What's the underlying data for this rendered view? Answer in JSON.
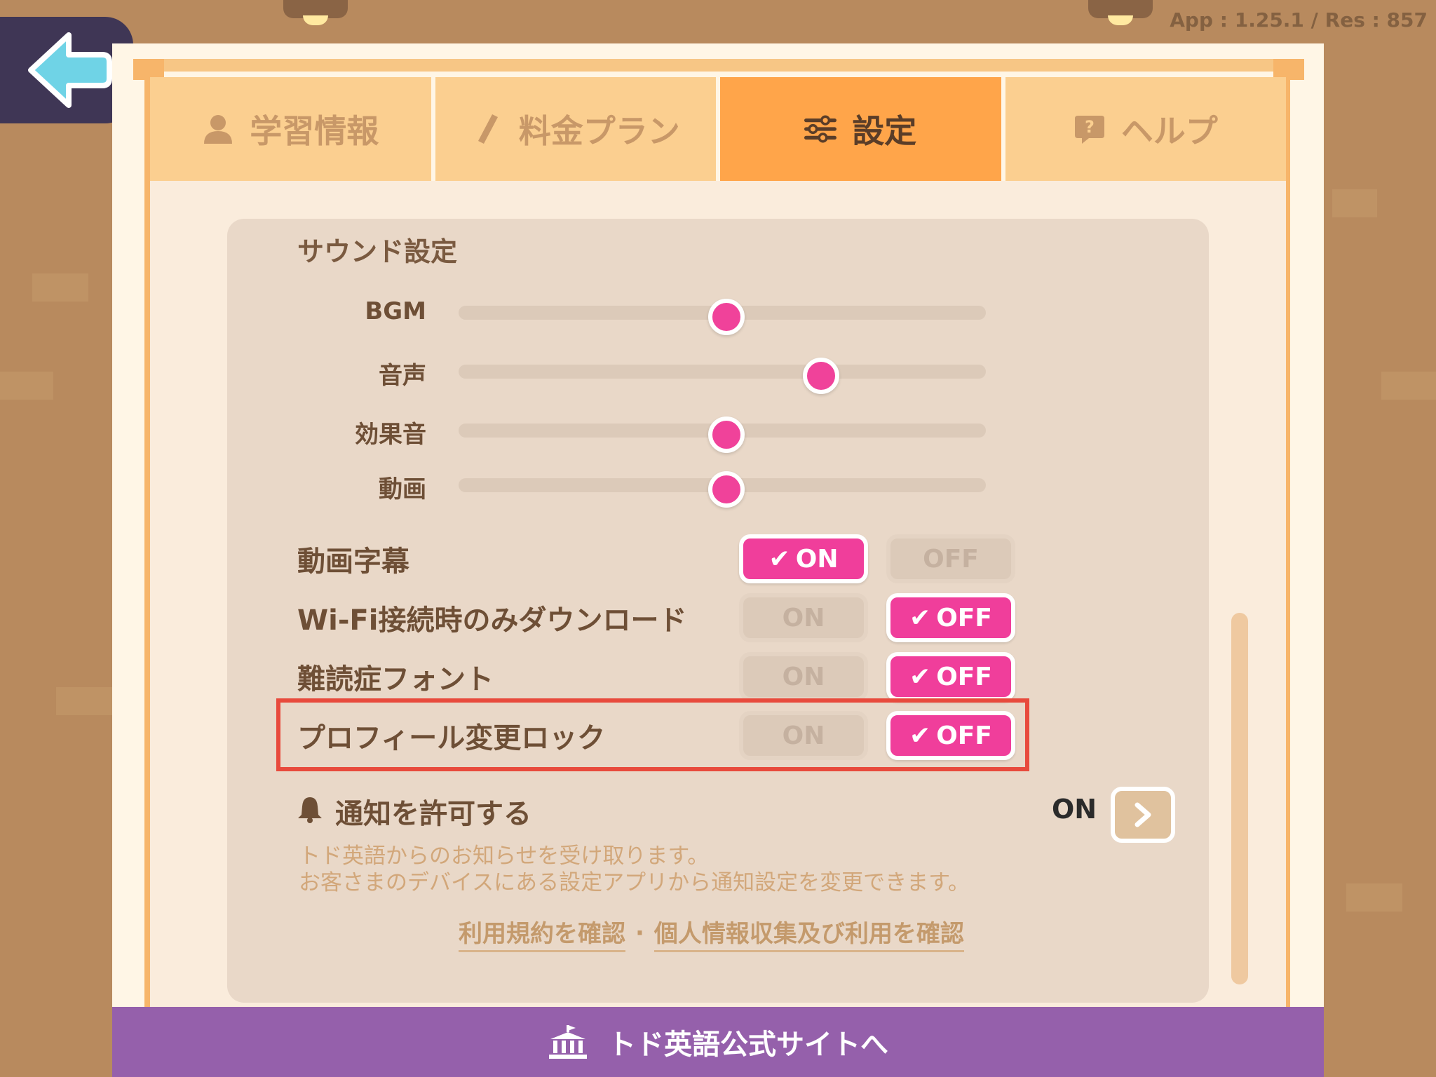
{
  "version_text": "App : 1.25.1 / Res : 857",
  "tabs": [
    {
      "label": "学習情報",
      "icon": "person-icon"
    },
    {
      "label": "料金プラン",
      "icon": "pen-icon"
    },
    {
      "label": "設定",
      "icon": "sliders-icon",
      "active": true
    },
    {
      "label": "ヘルプ",
      "icon": "help-icon"
    }
  ],
  "sound": {
    "title": "サウンド設定",
    "sliders": [
      {
        "label": "BGM",
        "value": 0.5
      },
      {
        "label": "音声",
        "value": 0.68
      },
      {
        "label": "効果音",
        "value": 0.5
      },
      {
        "label": "動画",
        "value": 0.5
      }
    ]
  },
  "toggles": [
    {
      "label": "動画字幕",
      "on_label": "ON",
      "off_label": "OFF",
      "selected": "on"
    },
    {
      "label": "Wi-Fi接続時のみダウンロード",
      "on_label": "ON",
      "off_label": "OFF",
      "selected": "off"
    },
    {
      "label": "難読症フォント",
      "on_label": "ON",
      "off_label": "OFF",
      "selected": "off"
    },
    {
      "label": "プロフィール変更ロック",
      "on_label": "ON",
      "off_label": "OFF",
      "selected": "off"
    }
  ],
  "notification": {
    "label": "通知を許可する",
    "status": "ON",
    "desc_line1": "トド英語からのお知らせを受け取ります。",
    "desc_line2": "お客さまのデバイスにある設定アプリから通知設定を変更できます。"
  },
  "links": {
    "terms": "利用規約を確認",
    "separator": "·",
    "privacy": "個人情報収集及び利用を確認"
  },
  "footer": {
    "label": "トド英語公式サイトへ"
  },
  "colors": {
    "accent_pink": "#f03e9b",
    "tab_active": "#ffa54a",
    "footer": "#9560ab",
    "highlight": "#e84a3c"
  }
}
